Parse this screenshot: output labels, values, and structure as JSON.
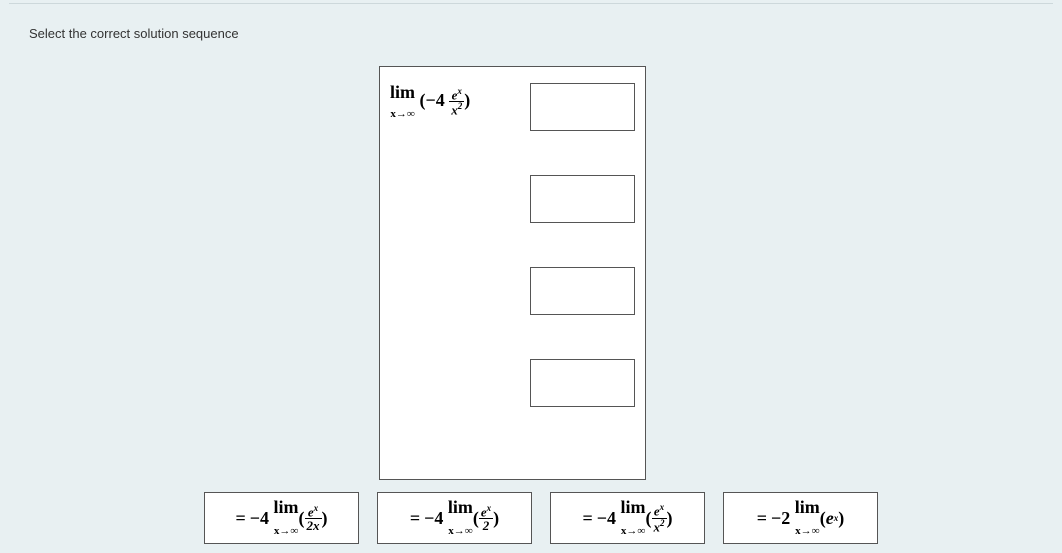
{
  "prompt": "Select the correct solution sequence",
  "fixed": {
    "lim": "lim",
    "sub": "x→∞",
    "factor": "−4",
    "frac_num": "eˣ",
    "frac_den": "x²"
  },
  "tiles": [
    {
      "eq": "=",
      "coef": "−4",
      "lim": "lim",
      "sub": "x→∞",
      "lp": "(",
      "num": "eˣ",
      "den": "2x",
      "rp": ")"
    },
    {
      "eq": "=",
      "coef": "−4",
      "lim": "lim",
      "sub": "x→∞",
      "lp": "(",
      "num": "eˣ",
      "den": "2",
      "rp": ")"
    },
    {
      "eq": "=",
      "coef": "−4",
      "lim": "lim",
      "sub": "x→∞",
      "lp": "(",
      "num": "eˣ",
      "den": "x²",
      "rp": ")"
    },
    {
      "eq": "=",
      "coef": "−2",
      "lim": "lim",
      "sub": "x→∞",
      "lp": "(",
      "inner": "eˣ",
      "rp": ")"
    }
  ]
}
